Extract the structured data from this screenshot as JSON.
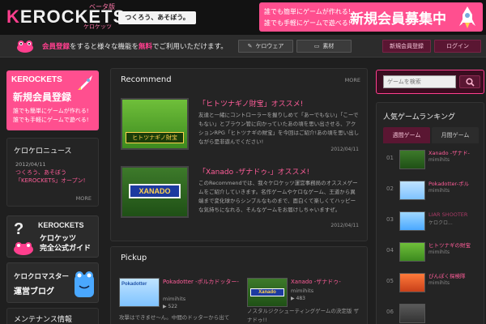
{
  "header": {
    "logo_k": "K",
    "logo_rest": "EROCKETS",
    "logo_sub": "ベータ版",
    "logo_kana": "ケロケッツ",
    "tagline": "つくろう、あそぼう。",
    "banner": {
      "line1": "誰でも簡単にゲームが作れる!",
      "line2": "誰でも手軽にゲームで遊べる!",
      "big": "新規会員募集中"
    }
  },
  "navbar": {
    "notice_pre": "会員登録",
    "notice_mid": "をすると様々な機能を",
    "notice_free": "無料",
    "notice_post": "でご利用いただけます。",
    "buttons": {
      "kerowear": "ケロウェア",
      "material": "素材",
      "register": "新規会員登録",
      "login": "ログイン"
    }
  },
  "left": {
    "side_banner": {
      "brand": "KEROCKETS",
      "title": "新規会員登録",
      "line1": "誰でも簡単にゲームが作れる!",
      "line2": "誰でも手軽にゲームで遊べる!"
    },
    "news": {
      "title": "ケロケロニュース",
      "date": "2012/04/11",
      "text1": "つくろう、あそぼう",
      "text2": "「KEROCKETS」オープン!",
      "more": "MORE"
    },
    "guide": {
      "qmark": "?",
      "brand": "KEROCKETS",
      "line1": "ケロケッツ",
      "line2": "完全公式ガイド"
    },
    "blog": {
      "line1": "ケロクロマスター",
      "line2": "運営ブログ"
    },
    "maintenance": {
      "title": "メンテナンス情報"
    }
  },
  "recommend": {
    "title": "Recommend",
    "more": "MORE",
    "items": [
      {
        "title": "「ヒトツナギノ財宝」オススメ!",
        "desc": "友達と一緒にコントローラーを握りしめて「あーでもない」「こーでもない」とブラウン管に向かっていたあの頃を思い出させる、アクションRPG「ヒトツナギの財宝」を今回はご紹介!あの頃を思い出しながら是非遊んでください!",
        "date": "2012/04/11",
        "thumb_text": "ヒトツナギノ財宝"
      },
      {
        "title": "「Xanado -ザナドゥ-」オススメ!",
        "desc": "このRecommendでは、我々ケロケッツ運営事務局のオススメゲームをご紹介していきます。名作ゲームやケロなゲーム、王道から異端まで変化球からシンプルなものまで、面白くて楽しくてハッピーな気持ちになれる、そんなゲームをお届けしちゃいますぜ。",
        "date": "2012/04/11",
        "thumb_text": "XANADO"
      }
    ]
  },
  "pickup": {
    "title": "Pickup",
    "items": [
      {
        "title": "Pokadotter -ポルカドッター-",
        "author": "mimihits",
        "count": "522",
        "desc": "攻撃はできませ〜ん。中間のドッターから出てくるこの・・・",
        "thumb_text": "Pokadotter"
      },
      {
        "title": "Xanado -ザナドゥ-",
        "author": "mimihits",
        "count": "483",
        "desc": "ノスタルジクシューティングゲームの決定版 ザナドゥ!!",
        "thumb_text": "Xanado"
      }
    ]
  },
  "search": {
    "placeholder": "ゲームを検索"
  },
  "ranking": {
    "title": "人気ゲームランキング",
    "tabs": {
      "weekly": "週間ゲーム",
      "monthly": "月間ゲーム"
    },
    "items": [
      {
        "num": "01",
        "title": "Xanado -ザナド-",
        "author": "mimihits"
      },
      {
        "num": "02",
        "title": "Pokadotter-ポル",
        "author": "mimihits"
      },
      {
        "num": "03",
        "title": "LIAR SHOOTER",
        "author": "ケロクロ..."
      },
      {
        "num": "04",
        "title": "ヒトツナギの財宝",
        "author": "mimihits"
      },
      {
        "num": "05",
        "title": "ぴんぽく探検隊",
        "author": "mimihits"
      },
      {
        "num": "06",
        "title": "",
        "author": ""
      }
    ]
  },
  "colors": {
    "accent": "#ff3f8e",
    "background": "#1f1f1f",
    "panel": "#242424",
    "link": "#ff5d99"
  }
}
